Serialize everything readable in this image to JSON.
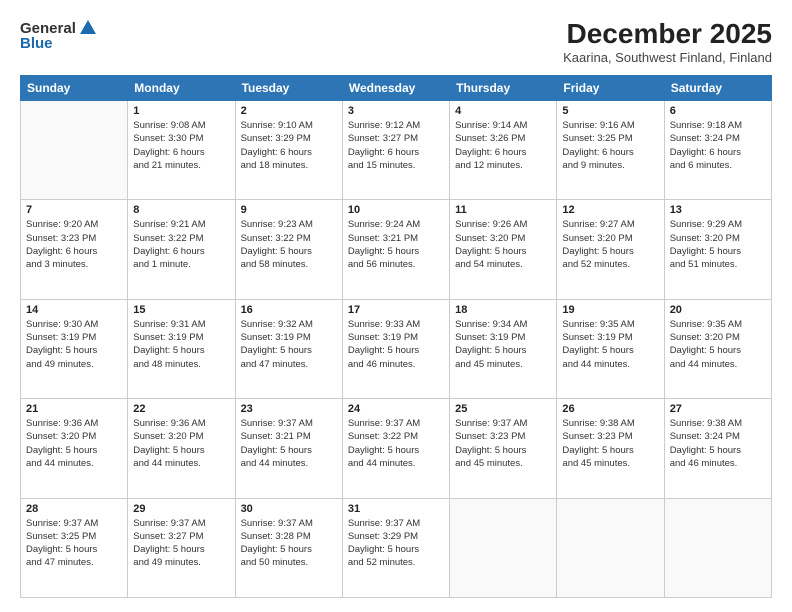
{
  "header": {
    "logo_general": "General",
    "logo_blue": "Blue",
    "title": "December 2025",
    "subtitle": "Kaarina, Southwest Finland, Finland"
  },
  "calendar": {
    "days_of_week": [
      "Sunday",
      "Monday",
      "Tuesday",
      "Wednesday",
      "Thursday",
      "Friday",
      "Saturday"
    ],
    "weeks": [
      [
        {
          "day": "",
          "info": ""
        },
        {
          "day": "1",
          "info": "Sunrise: 9:08 AM\nSunset: 3:30 PM\nDaylight: 6 hours\nand 21 minutes."
        },
        {
          "day": "2",
          "info": "Sunrise: 9:10 AM\nSunset: 3:29 PM\nDaylight: 6 hours\nand 18 minutes."
        },
        {
          "day": "3",
          "info": "Sunrise: 9:12 AM\nSunset: 3:27 PM\nDaylight: 6 hours\nand 15 minutes."
        },
        {
          "day": "4",
          "info": "Sunrise: 9:14 AM\nSunset: 3:26 PM\nDaylight: 6 hours\nand 12 minutes."
        },
        {
          "day": "5",
          "info": "Sunrise: 9:16 AM\nSunset: 3:25 PM\nDaylight: 6 hours\nand 9 minutes."
        },
        {
          "day": "6",
          "info": "Sunrise: 9:18 AM\nSunset: 3:24 PM\nDaylight: 6 hours\nand 6 minutes."
        }
      ],
      [
        {
          "day": "7",
          "info": "Sunrise: 9:20 AM\nSunset: 3:23 PM\nDaylight: 6 hours\nand 3 minutes."
        },
        {
          "day": "8",
          "info": "Sunrise: 9:21 AM\nSunset: 3:22 PM\nDaylight: 6 hours\nand 1 minute."
        },
        {
          "day": "9",
          "info": "Sunrise: 9:23 AM\nSunset: 3:22 PM\nDaylight: 5 hours\nand 58 minutes."
        },
        {
          "day": "10",
          "info": "Sunrise: 9:24 AM\nSunset: 3:21 PM\nDaylight: 5 hours\nand 56 minutes."
        },
        {
          "day": "11",
          "info": "Sunrise: 9:26 AM\nSunset: 3:20 PM\nDaylight: 5 hours\nand 54 minutes."
        },
        {
          "day": "12",
          "info": "Sunrise: 9:27 AM\nSunset: 3:20 PM\nDaylight: 5 hours\nand 52 minutes."
        },
        {
          "day": "13",
          "info": "Sunrise: 9:29 AM\nSunset: 3:20 PM\nDaylight: 5 hours\nand 51 minutes."
        }
      ],
      [
        {
          "day": "14",
          "info": "Sunrise: 9:30 AM\nSunset: 3:19 PM\nDaylight: 5 hours\nand 49 minutes."
        },
        {
          "day": "15",
          "info": "Sunrise: 9:31 AM\nSunset: 3:19 PM\nDaylight: 5 hours\nand 48 minutes."
        },
        {
          "day": "16",
          "info": "Sunrise: 9:32 AM\nSunset: 3:19 PM\nDaylight: 5 hours\nand 47 minutes."
        },
        {
          "day": "17",
          "info": "Sunrise: 9:33 AM\nSunset: 3:19 PM\nDaylight: 5 hours\nand 46 minutes."
        },
        {
          "day": "18",
          "info": "Sunrise: 9:34 AM\nSunset: 3:19 PM\nDaylight: 5 hours\nand 45 minutes."
        },
        {
          "day": "19",
          "info": "Sunrise: 9:35 AM\nSunset: 3:19 PM\nDaylight: 5 hours\nand 44 minutes."
        },
        {
          "day": "20",
          "info": "Sunrise: 9:35 AM\nSunset: 3:20 PM\nDaylight: 5 hours\nand 44 minutes."
        }
      ],
      [
        {
          "day": "21",
          "info": "Sunrise: 9:36 AM\nSunset: 3:20 PM\nDaylight: 5 hours\nand 44 minutes."
        },
        {
          "day": "22",
          "info": "Sunrise: 9:36 AM\nSunset: 3:20 PM\nDaylight: 5 hours\nand 44 minutes."
        },
        {
          "day": "23",
          "info": "Sunrise: 9:37 AM\nSunset: 3:21 PM\nDaylight: 5 hours\nand 44 minutes."
        },
        {
          "day": "24",
          "info": "Sunrise: 9:37 AM\nSunset: 3:22 PM\nDaylight: 5 hours\nand 44 minutes."
        },
        {
          "day": "25",
          "info": "Sunrise: 9:37 AM\nSunset: 3:23 PM\nDaylight: 5 hours\nand 45 minutes."
        },
        {
          "day": "26",
          "info": "Sunrise: 9:38 AM\nSunset: 3:23 PM\nDaylight: 5 hours\nand 45 minutes."
        },
        {
          "day": "27",
          "info": "Sunrise: 9:38 AM\nSunset: 3:24 PM\nDaylight: 5 hours\nand 46 minutes."
        }
      ],
      [
        {
          "day": "28",
          "info": "Sunrise: 9:37 AM\nSunset: 3:25 PM\nDaylight: 5 hours\nand 47 minutes."
        },
        {
          "day": "29",
          "info": "Sunrise: 9:37 AM\nSunset: 3:27 PM\nDaylight: 5 hours\nand 49 minutes."
        },
        {
          "day": "30",
          "info": "Sunrise: 9:37 AM\nSunset: 3:28 PM\nDaylight: 5 hours\nand 50 minutes."
        },
        {
          "day": "31",
          "info": "Sunrise: 9:37 AM\nSunset: 3:29 PM\nDaylight: 5 hours\nand 52 minutes."
        },
        {
          "day": "",
          "info": ""
        },
        {
          "day": "",
          "info": ""
        },
        {
          "day": "",
          "info": ""
        }
      ]
    ]
  }
}
